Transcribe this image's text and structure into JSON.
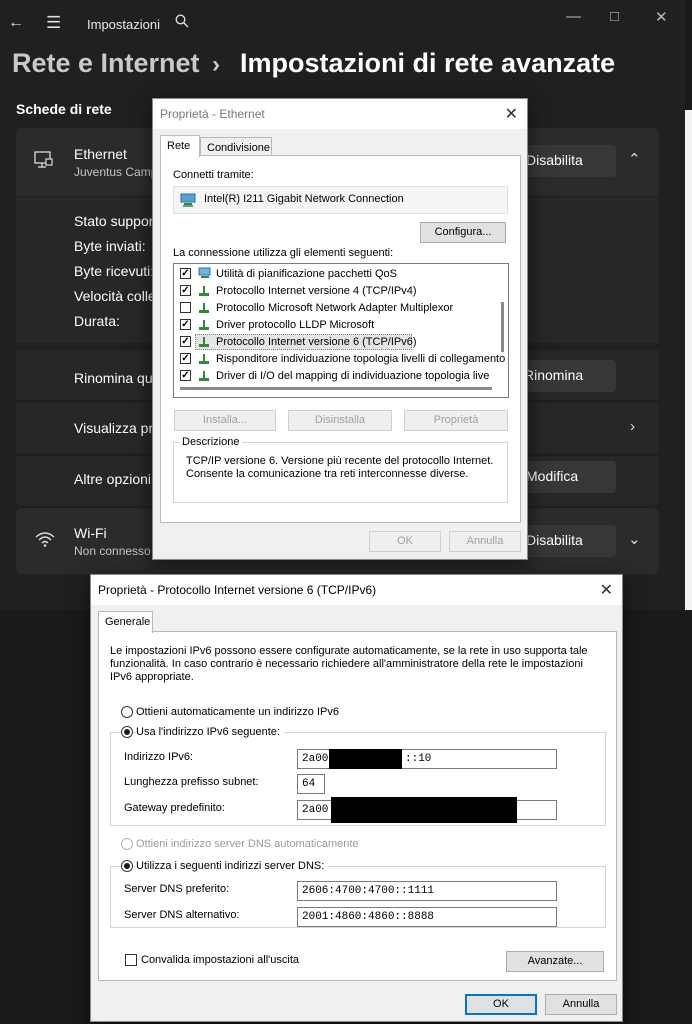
{
  "settings": {
    "app_title": "Impostazioni",
    "breadcrumb": [
      "Rete e Internet",
      "Impostazioni di rete avanzate"
    ],
    "section_title": "Schede di rete",
    "ethernet": {
      "name": "Ethernet",
      "subtitle": "Juventus Camp",
      "disable_label": "Disabilita",
      "details": [
        "Stato suppor",
        "Byte inviati:",
        "Byte ricevuti:",
        "Velocità colle",
        "Durata:"
      ]
    },
    "rename": {
      "label": "Rinomina qu",
      "button": "Rinomina"
    },
    "view": {
      "label": "Visualizza pr"
    },
    "more": {
      "label": "Altre opzioni",
      "button": "Modifica"
    },
    "wifi": {
      "name": "Wi-Fi",
      "subtitle": "Non connesso",
      "disable_label": "Disabilita"
    }
  },
  "eth_dialog": {
    "title": "Proprietà - Ethernet",
    "tabs": [
      "Rete",
      "Condivisione"
    ],
    "connect_using": "Connetti tramite:",
    "adapter": "Intel(R) I211 Gigabit Network Connection",
    "configure": "Configura...",
    "uses_items": "La connessione utilizza gli elementi seguenti:",
    "items": [
      {
        "label": "Utilità di pianificazione pacchetti QoS",
        "checked": true
      },
      {
        "label": "Protocollo Internet versione 4 (TCP/IPv4)",
        "checked": true
      },
      {
        "label": "Protocollo Microsoft Network Adapter Multiplexor",
        "checked": false
      },
      {
        "label": "Driver protocollo LLDP Microsoft",
        "checked": true
      },
      {
        "label": "Protocollo Internet versione 6 (TCP/IPv6)",
        "checked": true
      },
      {
        "label": "Risponditore individuazione topologia livelli di collegamento",
        "checked": true
      },
      {
        "label": "Driver di I/O del mapping di individuazione topologia livelli d",
        "checked": true
      }
    ],
    "install": "Installa...",
    "uninstall": "Disinstalla",
    "properties": "Proprietà",
    "description_title": "Descrizione",
    "description": [
      "TCP/IP versione 6. Versione più recente del protocollo Internet.",
      "Consente la comunicazione tra reti interconnesse diverse."
    ],
    "ok": "OK",
    "cancel": "Annulla"
  },
  "ipv6_dialog": {
    "title": "Proprietà - Protocollo Internet versione 6 (TCP/IPv6)",
    "tab": "Generale",
    "intro": [
      "Le impostazioni IPv6 possono essere configurate automaticamente, se la rete in uso supporta tale",
      "funzionalità. In caso contrario è necessario richiedere all'amministratore della rete le impostazioni",
      "IPv6 appropriate."
    ],
    "auto_ip": "Ottieni automaticamente un indirizzo IPv6",
    "manual_ip": "Usa l'indirizzo IPv6 seguente:",
    "ip_label": "Indirizzo IPv6:",
    "ip_prefix": "2a00:",
    "ip_suffix": "::10",
    "prefix_label": "Lunghezza prefisso subnet:",
    "prefix_value": "64",
    "gateway_label": "Gateway predefinito:",
    "gateway_prefix": "2a00:",
    "auto_dns": "Ottieni indirizzo server DNS automaticamente",
    "manual_dns": "Utilizza i seguenti indirizzi server DNS:",
    "dns1_label": "Server DNS preferito:",
    "dns1_value": "2606:4700:4700::1111",
    "dns2_label": "Server DNS alternativo:",
    "dns2_value": "2001:4860:4860::8888",
    "validate": "Convalida impostazioni all'uscita",
    "advanced": "Avanzate...",
    "ok": "OK",
    "cancel": "Annulla"
  }
}
